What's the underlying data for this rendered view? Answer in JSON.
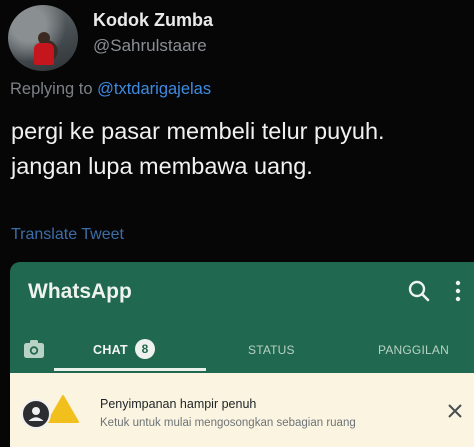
{
  "tweet": {
    "display_name": "Kodok Zumba",
    "handle": "@Sahrulstaare",
    "reply_prefix": "Replying to ",
    "reply_mention": "@txtdarigajelas",
    "body_line1": "pergi ke pasar membeli telur puyuh.",
    "body_line2": "jangan lupa membawa uang.",
    "translate": "Translate Tweet"
  },
  "whatsapp": {
    "title": "WhatsApp",
    "tabs": {
      "chat": "CHAT",
      "chat_badge": "8",
      "status": "STATUS",
      "calls": "PANGGILAN"
    },
    "banner": {
      "title": "Penyimpanan hampir penuh",
      "subtitle": "Ketuk untuk mulai mengosongkan sebagian ruang"
    }
  },
  "icons": {
    "search": "search-icon",
    "more": "more-vertical-icon",
    "camera": "camera-icon",
    "warning": "warning-icon",
    "close": "close-icon",
    "user": "user-icon"
  },
  "colors": {
    "background": "#060607",
    "mention": "#3f8be3",
    "whatsapp_green": "#20684f",
    "banner_bg": "#fbf4e0",
    "warning_yellow": "#f2c01d"
  }
}
